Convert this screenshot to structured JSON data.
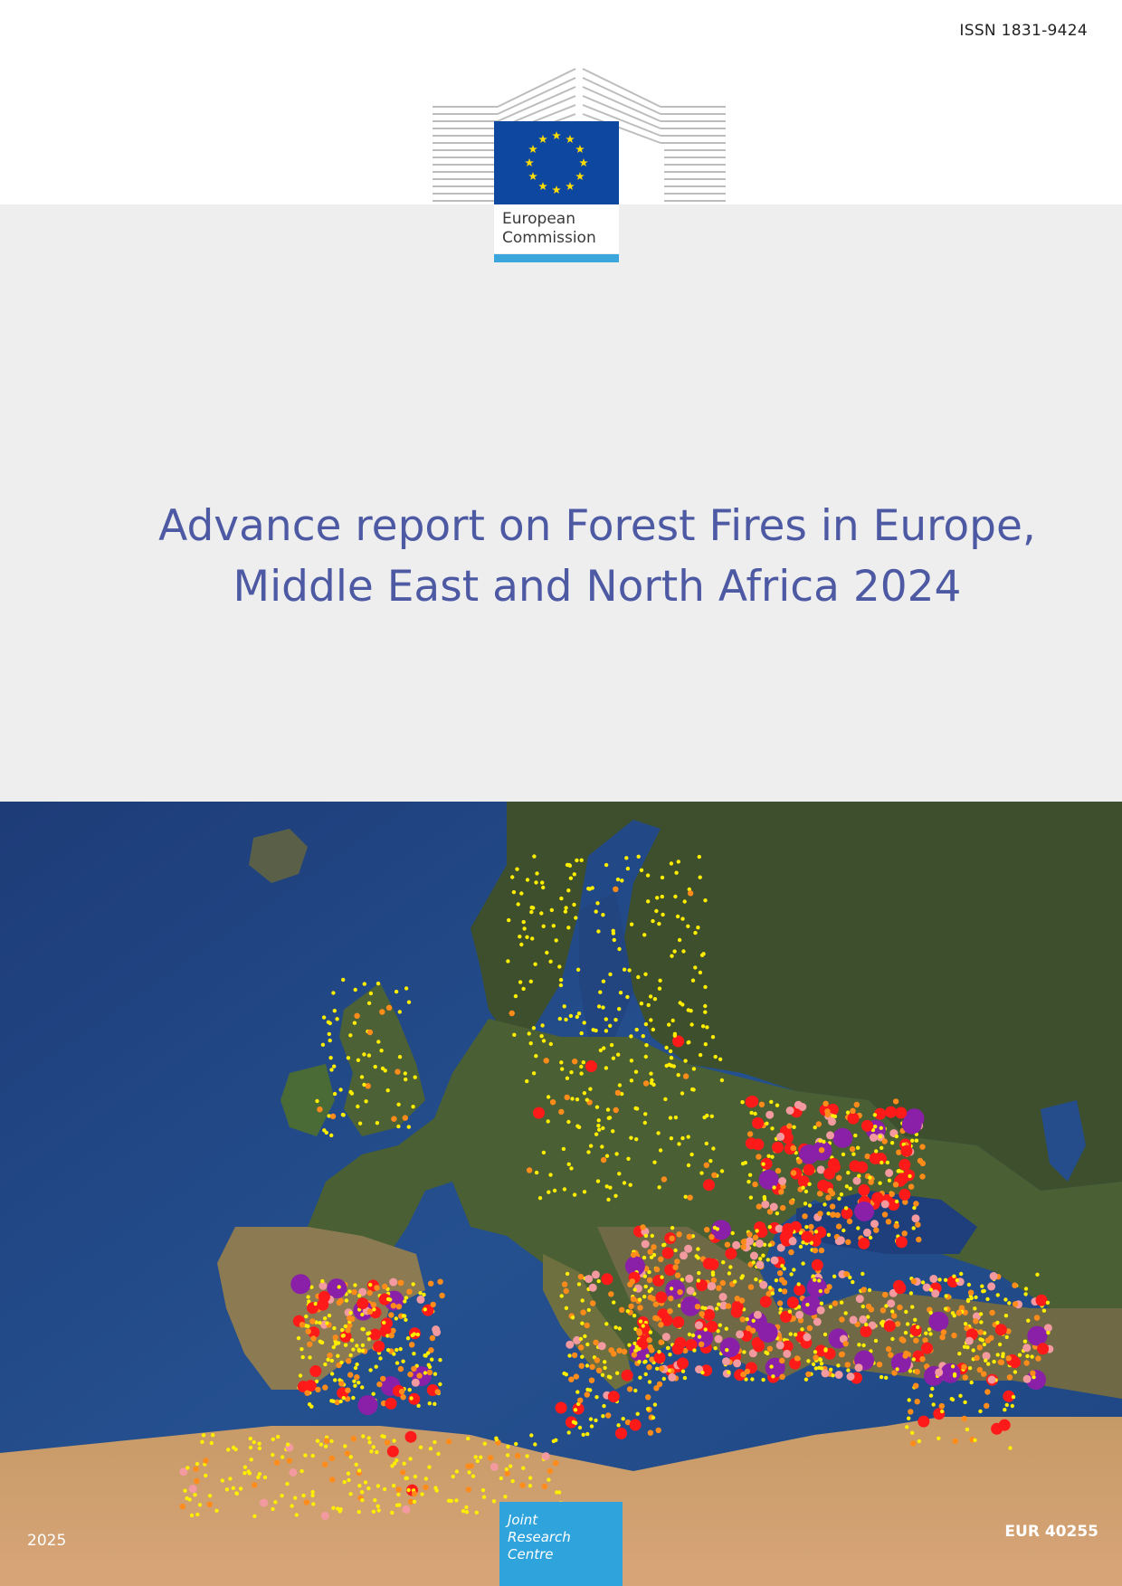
{
  "header": {
    "issn": "ISSN 1831-9424"
  },
  "logo": {
    "org_line1": "European",
    "org_line2": "Commission",
    "flag_color": "#0e47a0",
    "star_color": "#ffdd00",
    "accent_color": "#3aa6dc"
  },
  "title": {
    "line1": "Advance report on Forest Fires in Europe,",
    "line2": "Middle East and North Africa 2024",
    "color": "#4d5aa3"
  },
  "cover_image": {
    "legend_colors": [
      "#ffee00",
      "#ff8c1a",
      "#f29aa0",
      "#ff1a1a",
      "#8a1fa8"
    ]
  },
  "footer": {
    "year": "2025",
    "jrc_line1": "Joint",
    "jrc_line2": "Research",
    "jrc_line3": "Centre",
    "jrc_color": "#2ea3dc",
    "report_number": "EUR 40255"
  }
}
